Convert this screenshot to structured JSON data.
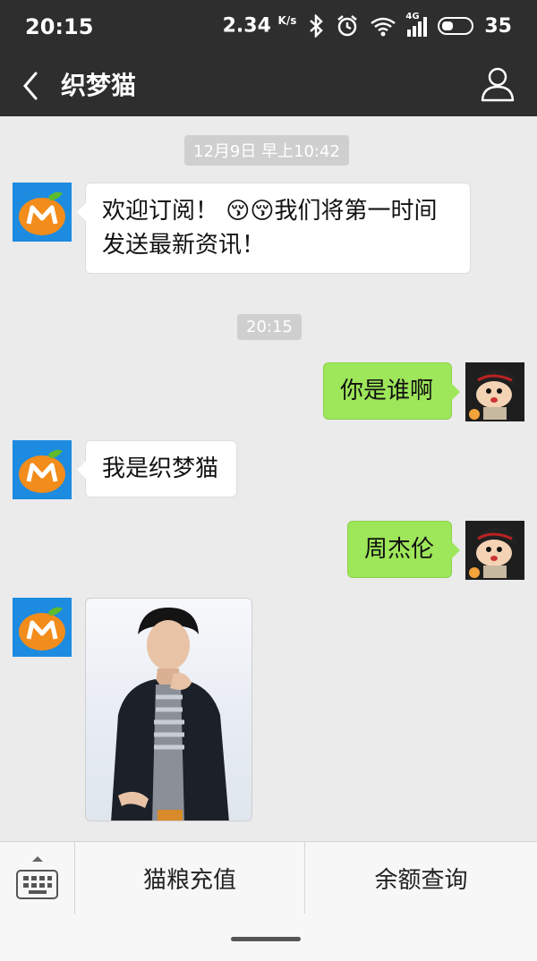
{
  "status_bar": {
    "time": "20:15",
    "net_speed": "2.34",
    "net_unit": "K/s",
    "battery": "35",
    "signal": "4G"
  },
  "header": {
    "title": "织梦猫"
  },
  "chat": {
    "timestamps": [
      "12月9日 早上10:42",
      "20:15"
    ],
    "messages": [
      {
        "side": "left",
        "text_line1": "欢迎订阅！ 😚😚我们将第一时间",
        "text_line2": "发送最新资讯！"
      },
      {
        "side": "right",
        "text": "你是谁啊"
      },
      {
        "side": "left",
        "text": "我是织梦猫"
      },
      {
        "side": "right",
        "text": "周杰伦"
      }
    ]
  },
  "bottom_menu": {
    "item1": "猫粮充值",
    "item2": "余额查询"
  },
  "colors": {
    "bar": "#2e2e2e",
    "sent_bubble": "#9ee65a",
    "brand_blue": "#1d8be0",
    "brand_orange": "#f28c1b"
  }
}
